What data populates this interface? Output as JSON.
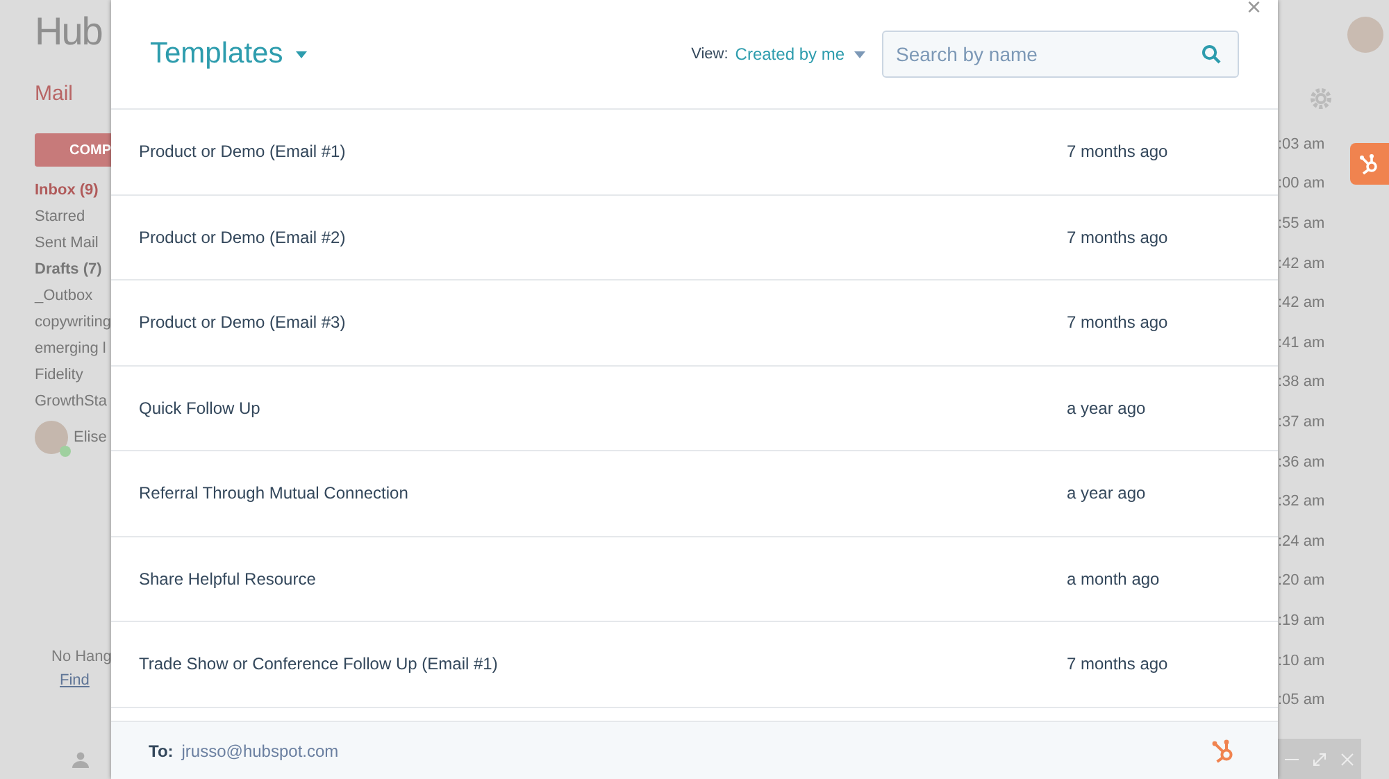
{
  "background": {
    "logo": "Hub",
    "mail_menu": "Mail",
    "compose_button": "COMP",
    "folders": [
      {
        "label": "Inbox (9)",
        "selected": true,
        "unread": true
      },
      {
        "label": "Starred",
        "selected": false,
        "unread": false
      },
      {
        "label": "Sent Mail",
        "selected": false,
        "unread": false
      },
      {
        "label": "Drafts (7)",
        "selected": false,
        "unread": true
      },
      {
        "label": "_Outbox",
        "selected": false,
        "unread": false
      },
      {
        "label": "copywriting",
        "selected": false,
        "unread": false
      },
      {
        "label": "emerging l",
        "selected": false,
        "unread": false
      },
      {
        "label": "Fidelity",
        "selected": false,
        "unread": false
      },
      {
        "label": "GrowthSta",
        "selected": false,
        "unread": false
      }
    ],
    "user": {
      "name": "Elise",
      "online": true
    },
    "empty_note": "No Hang",
    "empty_link": "Find",
    "times": [
      ":03 am",
      ":00 am",
      ":55 am",
      ":42 am",
      ":42 am",
      ":41 am",
      ":38 am",
      ":37 am",
      ":36 am",
      ":32 am",
      ":24 am",
      ":20 am",
      ":19 am",
      ":10 am",
      ":05 am"
    ]
  },
  "modal": {
    "close": "×",
    "title": "Templates",
    "view_label": "View:",
    "view_value": "Created by me",
    "search": {
      "placeholder": "Search by name"
    },
    "templates": [
      {
        "name": "Product or Demo (Email #1)",
        "updated": "7 months ago"
      },
      {
        "name": "Product or Demo (Email #2)",
        "updated": "7 months ago"
      },
      {
        "name": "Product or Demo (Email #3)",
        "updated": "7 months ago"
      },
      {
        "name": "Quick Follow Up",
        "updated": "a year ago"
      },
      {
        "name": "Referral Through Mutual Connection",
        "updated": "a year ago"
      },
      {
        "name": "Share Helpful Resource",
        "updated": "a month ago"
      },
      {
        "name": "Trade Show or Conference Follow Up (Email #1)",
        "updated": "7 months ago"
      }
    ],
    "footer": {
      "to_label": "To:",
      "to_value": "jrusso@hubspot.com"
    }
  }
}
